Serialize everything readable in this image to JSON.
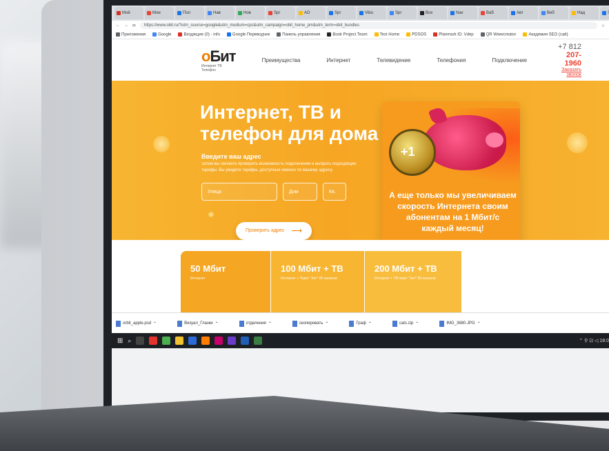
{
  "browser": {
    "tabs": [
      "Мой",
      "Мои",
      "Пол",
      "Нав",
      "Нов",
      "Spr",
      "АО",
      "Spr",
      "Vibo",
      "Spr",
      "Все",
      "Nav",
      "Ваб",
      "Авт",
      "Виб",
      "Над",
      "Sha",
      "Сбо"
    ],
    "url": "https://www.obit.ru/?utm_source=google&utm_medium=cpc&utm_campaign=obit_home_pm&utm_term=obit_bundles",
    "bookmarks": [
      "Приложения",
      "Google",
      "Входящие (0) - info",
      "Google Переводчик",
      "Панель управления",
      "Book Project Team",
      "Test Home",
      "PDSOS",
      "Planmark ID: Vdep",
      "QR Wwwcreator",
      "Академия SEO (сай)"
    ]
  },
  "site": {
    "logo": {
      "part1": "о",
      "part2": "Бит",
      "sub": "Интернет ТВ Телефон"
    },
    "nav": [
      "Преимущества",
      "Интернет",
      "Телевидение",
      "Телефония",
      "Подключение"
    ],
    "phone": {
      "prefix": "+7 812",
      "number": "207-1960",
      "order": "Заказать звонок"
    },
    "hero": {
      "title": "Интернет, ТВ и телефон для дома",
      "subtitle": "Введите ваш адрес",
      "desc": "Затем вы сможете проверить возможность подключения и выбрать подходящие тарифы. Вы увидите тарифы, доступные именно по вашему адресу.",
      "street_placeholder": "Улица",
      "house_placeholder": "Дом",
      "flat_placeholder": "Кв.",
      "check_button": "Проверить адрес",
      "arrow": "⟶"
    },
    "promo": {
      "coin": "+1",
      "text": "А еще только мы увеличиваем скорость Интернета своим абонентам на 1 Мбит/с каждый месяц!"
    },
    "tariffs": [
      {
        "name": "50 Мбит",
        "desc": "Интернет",
        "color": "#f5a623"
      },
      {
        "name": "100 Мбит + ТВ",
        "desc": "Интернет + Пакет \"Хит\" 80 каналов",
        "color": "#f7b531"
      },
      {
        "name": "200 Мбит + ТВ",
        "desc": "Интернет + ТВ пакет \"Хит\" 80 каналов",
        "color": "#f9bd3d"
      }
    ]
  },
  "downloads": [
    "orbit_apple.psd",
    "Визуал_Глазки",
    "отделения",
    "скопировать",
    "Граф",
    "cats.zip",
    "IMG_3680.JPG"
  ],
  "taskbar": {
    "tray": "⌃ ⚲ ⊡ ◁ 18:0"
  }
}
